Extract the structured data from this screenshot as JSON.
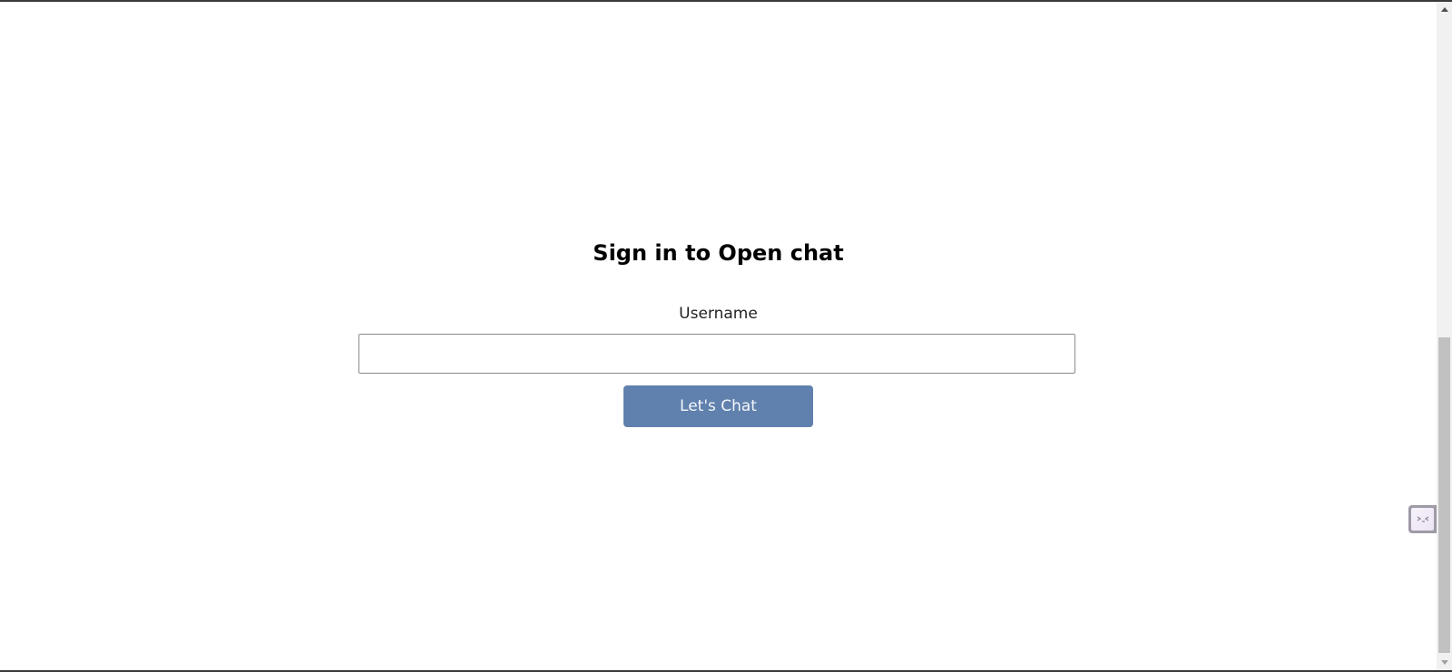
{
  "login": {
    "title": "Sign in to Open chat",
    "username_label": "Username",
    "username_value": "",
    "username_placeholder": "",
    "submit_label": "Let's Chat"
  },
  "widget": {
    "icon": "terminal-icon"
  },
  "colors": {
    "button_background": "#6081ad",
    "button_text": "#f4f6fa",
    "input_border": "#8a8a8a",
    "scroll_thumb": "#c1c1c1",
    "widget_frame": "#9e9ba6"
  }
}
